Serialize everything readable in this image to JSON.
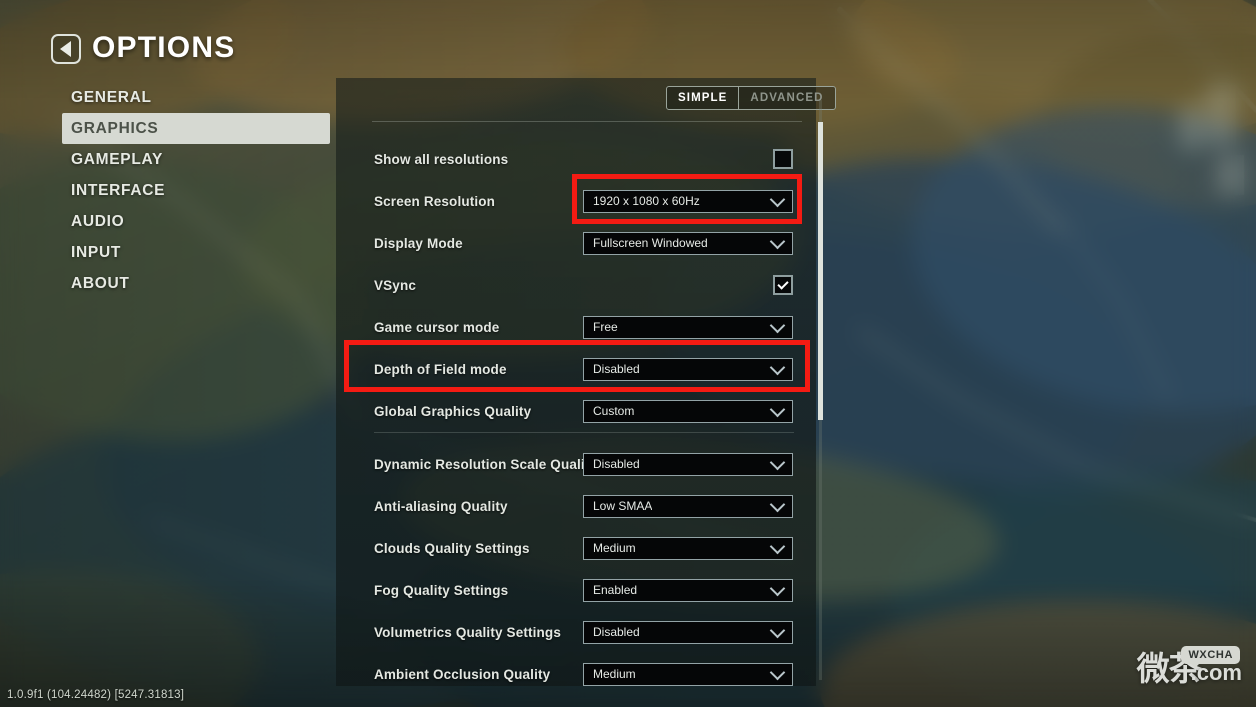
{
  "header": {
    "title": "OPTIONS",
    "back_icon": "back-arrow-icon"
  },
  "sidebar": {
    "items": [
      {
        "label": "GENERAL",
        "active": false
      },
      {
        "label": "GRAPHICS",
        "active": true
      },
      {
        "label": "GAMEPLAY",
        "active": false
      },
      {
        "label": "INTERFACE",
        "active": false
      },
      {
        "label": "AUDIO",
        "active": false
      },
      {
        "label": "INPUT",
        "active": false
      },
      {
        "label": "ABOUT",
        "active": false
      }
    ]
  },
  "tabs": [
    {
      "label": "SIMPLE",
      "active": true
    },
    {
      "label": "ADVANCED",
      "active": false
    }
  ],
  "settings": [
    {
      "label": "Show all resolutions",
      "control": "checkbox",
      "checked": false
    },
    {
      "label": "Screen Resolution",
      "control": "dropdown",
      "value": "1920 x 1080 x 60Hz"
    },
    {
      "label": "Display Mode",
      "control": "dropdown",
      "value": "Fullscreen Windowed"
    },
    {
      "label": "VSync",
      "control": "checkbox",
      "checked": true
    },
    {
      "label": "Game cursor mode",
      "control": "dropdown",
      "value": "Free"
    },
    {
      "label": "Depth of Field mode",
      "control": "dropdown",
      "value": "Disabled"
    },
    {
      "label": "Global Graphics Quality",
      "control": "dropdown",
      "value": "Custom"
    },
    {
      "label": "Dynamic Resolution Scale Quality",
      "control": "dropdown",
      "value": "Disabled"
    },
    {
      "label": "Anti-aliasing Quality",
      "control": "dropdown",
      "value": "Low SMAA"
    },
    {
      "label": "Clouds Quality Settings",
      "control": "dropdown",
      "value": "Medium"
    },
    {
      "label": "Fog Quality Settings",
      "control": "dropdown",
      "value": "Enabled"
    },
    {
      "label": "Volumetrics Quality Settings",
      "control": "dropdown",
      "value": "Disabled"
    },
    {
      "label": "Ambient Occlusion Quality",
      "control": "dropdown",
      "value": "Medium"
    }
  ],
  "highlights": [
    {
      "name": "screen-resolution",
      "color": "#f41b13"
    },
    {
      "name": "depth-of-field",
      "color": "#f41b13"
    }
  ],
  "footer": {
    "version": "1.0.9f1 (104.24482) [5247.31813]"
  },
  "watermark": {
    "text": "微茶",
    "suffix": ".com",
    "badge": "WXCHA"
  }
}
